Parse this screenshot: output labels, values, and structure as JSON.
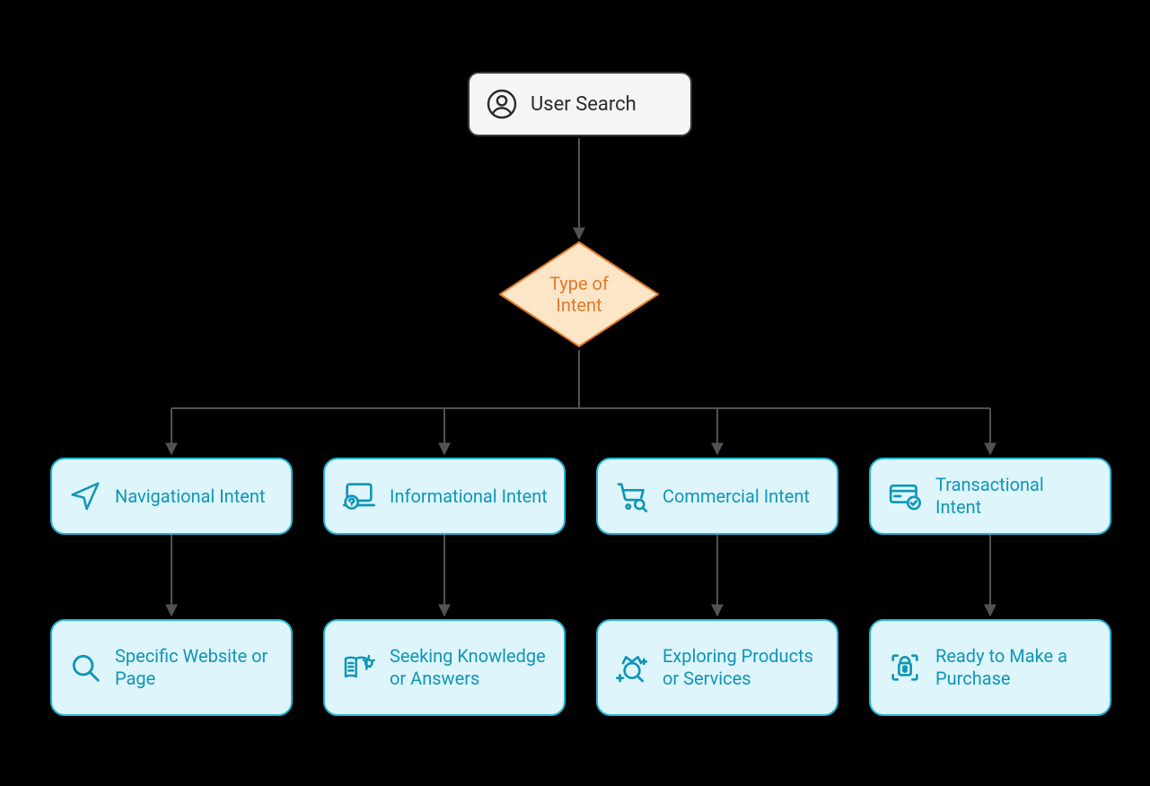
{
  "root": {
    "label": "User Search",
    "icon": "user-circle-icon"
  },
  "decision": {
    "label": "Type of Intent"
  },
  "intents": [
    {
      "title": "Navigational Intent",
      "outcome": "Specific Website or Page",
      "icon": "compass-arrow-icon",
      "outcome_icon": "magnifier-icon"
    },
    {
      "title": "Informational Intent",
      "outcome": "Seeking Knowledge or Answers",
      "icon": "laptop-question-icon",
      "outcome_icon": "book-idea-icon"
    },
    {
      "title": "Commercial Intent",
      "outcome": "Exploring Products or Services",
      "icon": "cart-search-icon",
      "outcome_icon": "crown-add-icon"
    },
    {
      "title": "Transactional Intent",
      "outcome": "Ready to Make a Purchase",
      "icon": "card-check-icon",
      "outcome_icon": "purchase-scan-icon"
    }
  ],
  "colors": {
    "connector": "#525252",
    "box_border": "#25b5d6",
    "box_fill": "#def5fb",
    "box_text": "#1096b6",
    "diamond_border": "#e07a2a",
    "diamond_fill": "#fde5c8",
    "root_fill": "#f5f5f5",
    "root_border": "#3a3a3a"
  }
}
